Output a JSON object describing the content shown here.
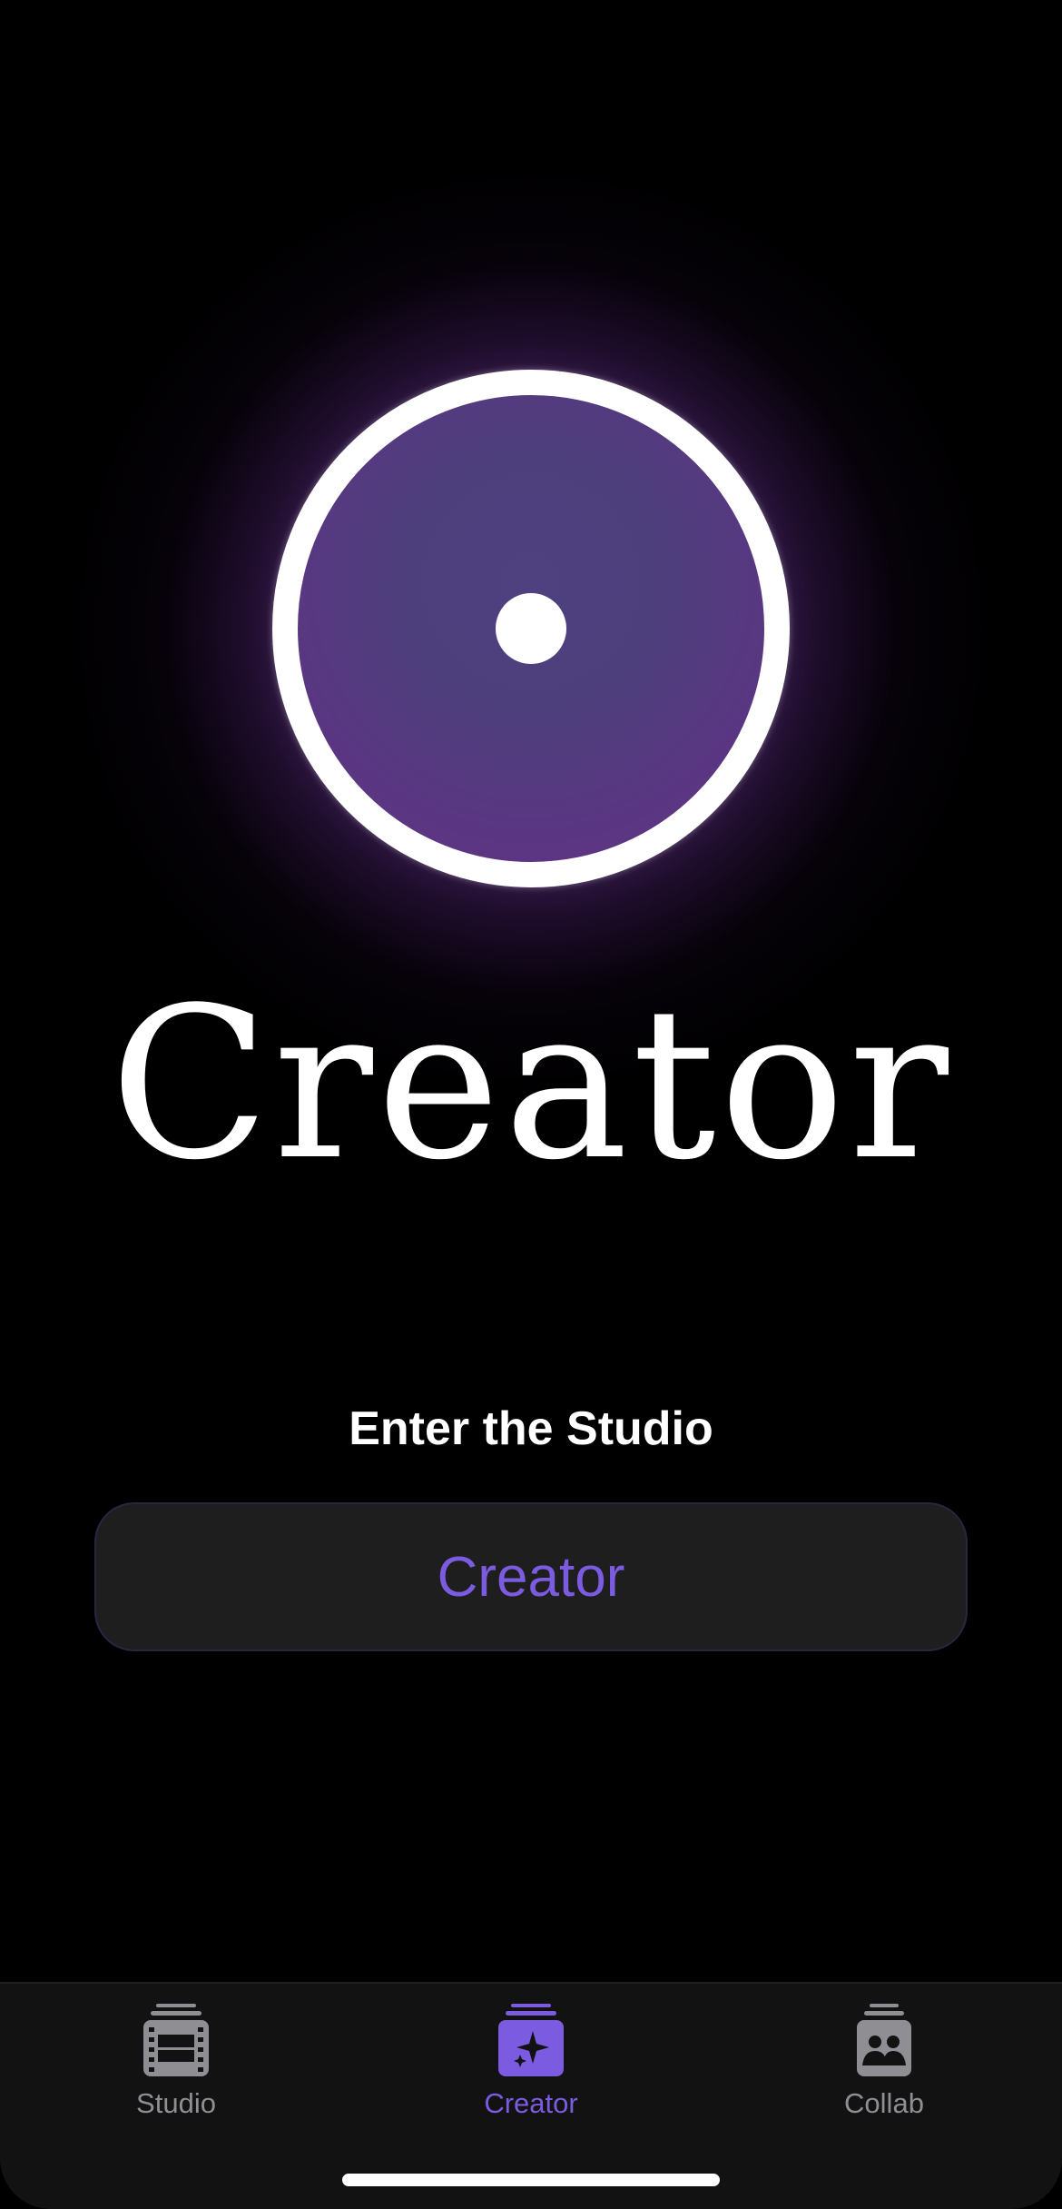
{
  "hero": {
    "title": "Creator"
  },
  "entry": {
    "label": "Enter the Studio",
    "button_label": "Creator"
  },
  "tabbar": {
    "active_tab": "Creator",
    "tabs": [
      {
        "label": "Studio",
        "icon": "film-stack-icon"
      },
      {
        "label": "Creator",
        "icon": "sparkle-stack-icon"
      },
      {
        "label": "Collab",
        "icon": "people-stack-icon"
      }
    ]
  },
  "colors": {
    "accent": "#7b5be0",
    "background": "#000000",
    "tab_inactive": "#8e8e93",
    "button_bg": "#1e1e1e"
  }
}
